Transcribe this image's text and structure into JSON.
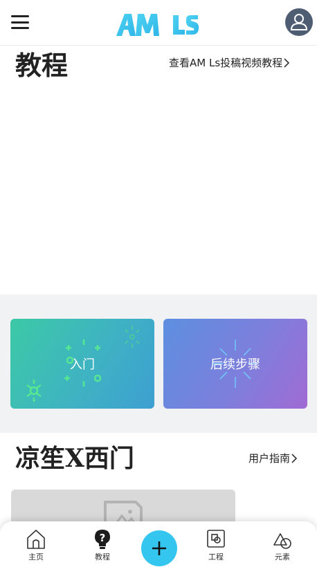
{
  "header": {
    "logo_text": "AM LS",
    "colors": {
      "logo": "#38c7ef",
      "avatar_bg": "#4f5d73"
    }
  },
  "tutorials": {
    "title": "教程",
    "more_link": "查看AM Ls投稿视频教程",
    "cards": [
      {
        "label": "入门"
      },
      {
        "label": "后续步骤"
      }
    ]
  },
  "creator_section": {
    "title": "凉笙X西门",
    "link": "用户指南"
  },
  "bottom_nav": {
    "items": [
      {
        "label": "主页",
        "icon": "home-icon"
      },
      {
        "label": "教程",
        "icon": "question-bulb-icon"
      },
      {
        "label": "",
        "icon": "plus-icon"
      },
      {
        "label": "工程",
        "icon": "project-icon"
      },
      {
        "label": "元素",
        "icon": "shapes-icon"
      }
    ],
    "colors": {
      "fab": "#35c6ef"
    }
  }
}
